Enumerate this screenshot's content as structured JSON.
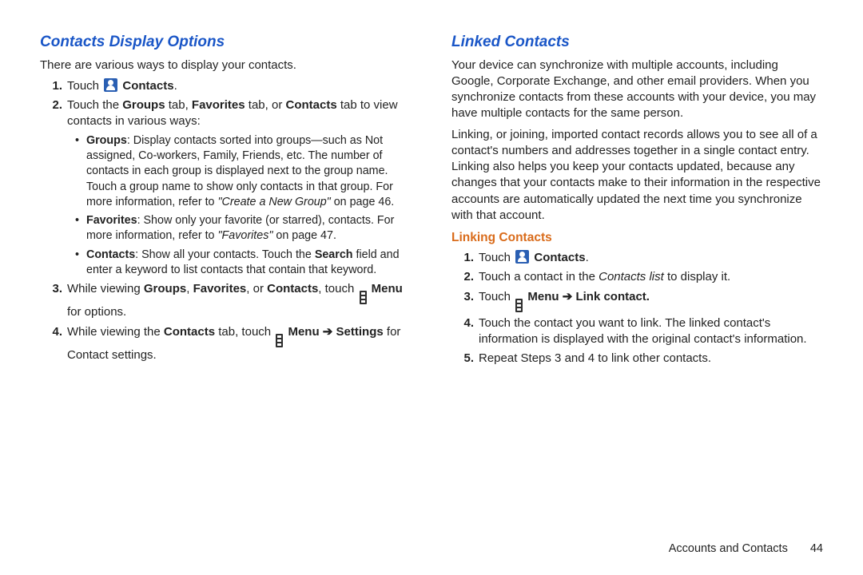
{
  "footer": {
    "label": "Accounts and Contacts",
    "page": "44"
  },
  "left": {
    "title": "Contacts Display Options",
    "intro": "There are various ways to display your contacts.",
    "step1": {
      "touch": "Touch ",
      "contacts": "Contacts",
      "period": "."
    },
    "step2": {
      "a": "Touch the ",
      "groups": "Groups",
      "b": " tab, ",
      "fav": "Favorites",
      "c": " tab, or ",
      "contacts": "Contacts",
      "d": " tab to view contacts in various ways:"
    },
    "b1": {
      "lead": "Groups",
      "t1": ": Display contacts sorted into groups—such as Not assigned, Co-workers, Family, Friends, etc. The number of contacts in each group is displayed next to the group name. Touch a group name to show only contacts in that group. For more information, refer to ",
      "ref": "\"Create a New Group\"",
      "t2": " on page 46."
    },
    "b2": {
      "lead": "Favorites",
      "t1": ": Show only your favorite (or starred), contacts. For more information, refer to ",
      "ref": "\"Favorites\"",
      "t2": " on page 47."
    },
    "b3": {
      "lead": "Contacts",
      "t1": ": Show all your contacts. Touch the ",
      "search": "Search",
      "t2": " field and enter a keyword to list contacts that contain that keyword."
    },
    "step3": {
      "a": "While viewing ",
      "g": "Groups",
      "c1": ", ",
      "f": "Favorites",
      "c2": ", or ",
      "c": "Contacts",
      "b": ", touch ",
      "menu": "Menu",
      "d": " for options."
    },
    "step4": {
      "a": "While viewing the ",
      "c": "Contacts",
      "b": " tab, touch ",
      "menu": "Menu",
      "arrow": " ➔ ",
      "set": "Settings",
      "d": " for Contact settings."
    }
  },
  "right": {
    "title": "Linked Contacts",
    "p1": "Your device can synchronize with multiple accounts, including Google, Corporate Exchange, and other email providers. When you synchronize contacts from these accounts with your device, you may have multiple contacts for the same person.",
    "p2": "Linking, or joining, imported contact records allows you to see all of a contact's numbers and addresses together in a single contact entry. Linking also helps you keep your contacts updated, because any changes that your contacts make to their information in the respective accounts are automatically updated the next time you synchronize with that account.",
    "sub": "Linking Contacts",
    "s1": {
      "touch": "Touch ",
      "contacts": "Contacts",
      "period": "."
    },
    "s2": {
      "a": "Touch a contact in the ",
      "list": "Contacts list",
      "b": " to display it."
    },
    "s3": {
      "touch": "Touch ",
      "menu": "Menu",
      "arrow": " ➔ ",
      "link": "Link contact."
    },
    "s4": "Touch the contact you want to link. The linked contact's information is displayed with the original contact's information.",
    "s5": "Repeat Steps 3 and 4 to link other contacts."
  }
}
